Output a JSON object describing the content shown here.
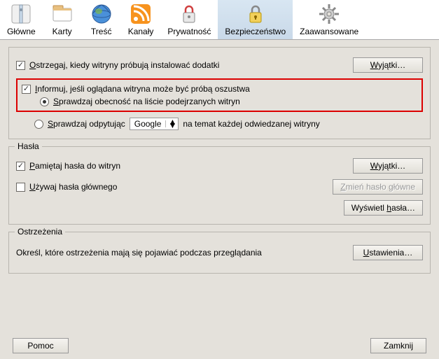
{
  "toolbar": {
    "items": [
      {
        "label": "Główne"
      },
      {
        "label": "Karty"
      },
      {
        "label": "Treść"
      },
      {
        "label": "Kanały"
      },
      {
        "label": "Prywatność"
      },
      {
        "label": "Bezpieczeństwo"
      },
      {
        "label": "Zaawansowane"
      }
    ]
  },
  "section1": {
    "warn_install": "strzegaj, kiedy witryny próbują instalować dodatki",
    "exceptions_btn": "yjątki…",
    "inform_fraud": "nformuj, jeśli oglądana witryna może być próbą oszustwa",
    "radio_list": "prawdzaj obecność na liście podejrzanych witryn",
    "radio_ask": "prawdzaj odpytując",
    "google": "Google",
    "radio_ask_suffix": "na temat każdej odwiedzanej witryny"
  },
  "passwords": {
    "legend": "Hasła",
    "remember": "amiętaj hasła do witryn",
    "exceptions_btn": "yjątki…",
    "use_master": "żywaj hasła głównego",
    "change_master_btn": "mień hasło główne",
    "show_btn_pre": "Wyświetl ",
    "show_btn_accel": "h",
    "show_btn_post": "asła…"
  },
  "warnings": {
    "legend": "Ostrzeżenia",
    "desc": "Określ, które ostrzeżenia mają się pojawiać podczas przeglądania",
    "settings_btn": "stawienia…"
  },
  "footer": {
    "help": "Pomoc",
    "close": "Zamknij"
  }
}
